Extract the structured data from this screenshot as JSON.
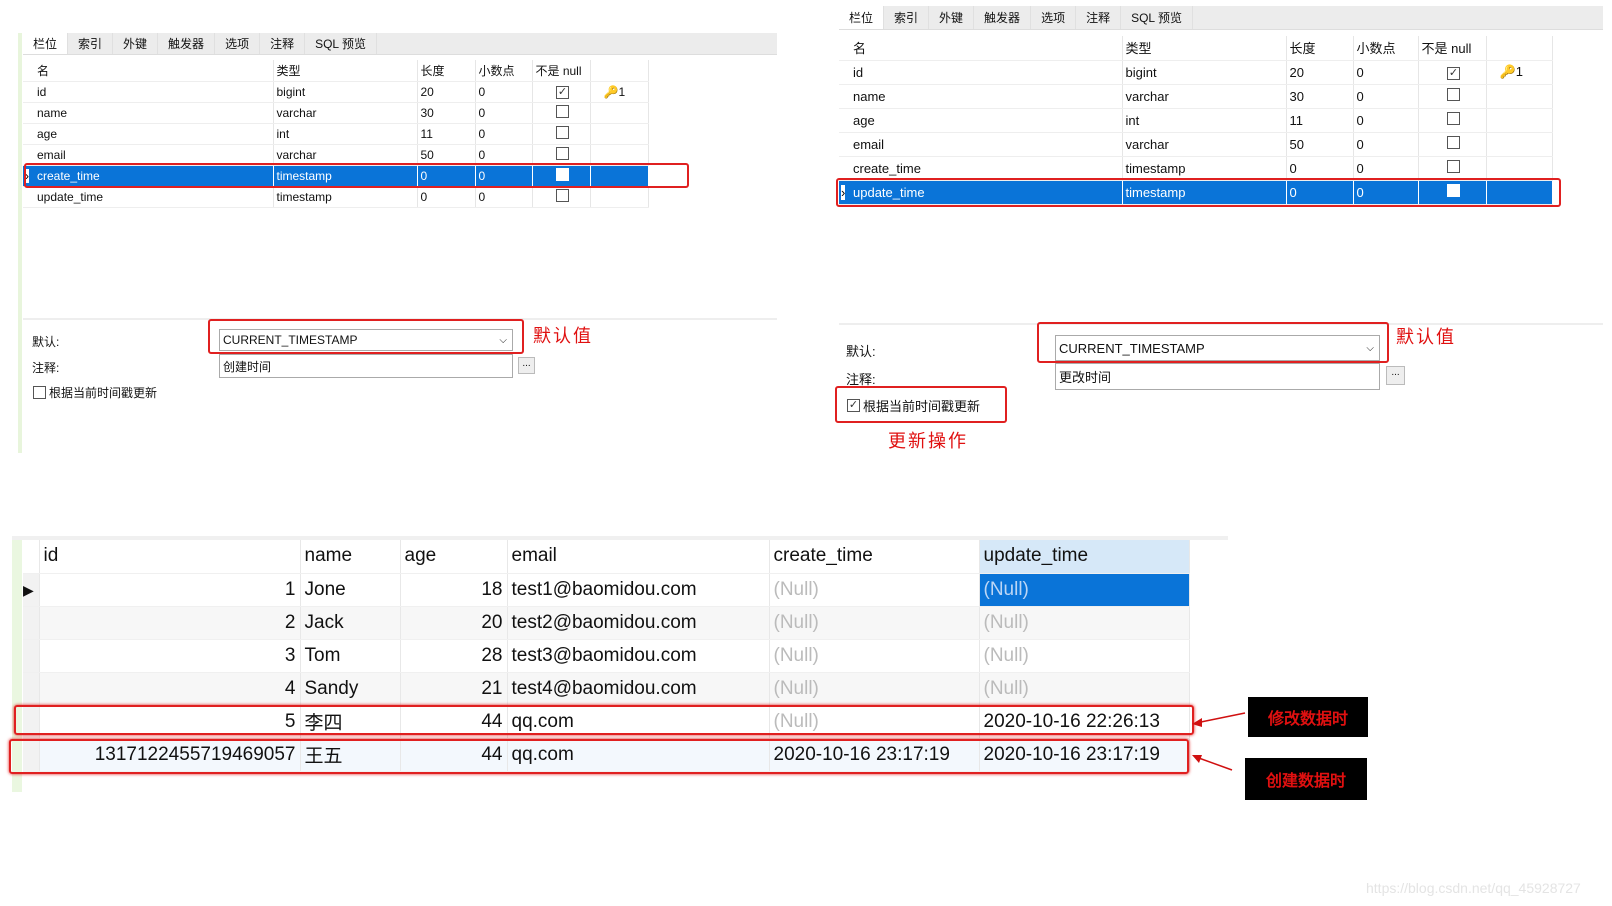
{
  "tabs": [
    "栏位",
    "索引",
    "外键",
    "触发器",
    "选项",
    "注释",
    "SQL 预览"
  ],
  "columns_header": [
    "名",
    "类型",
    "长度",
    "小数点",
    "不是 null",
    ""
  ],
  "fields": [
    {
      "name": "id",
      "type": "bigint",
      "length": "20",
      "decimal": "0",
      "not_null": true,
      "key": "1"
    },
    {
      "name": "name",
      "type": "varchar",
      "length": "30",
      "decimal": "0",
      "not_null": false,
      "key": ""
    },
    {
      "name": "age",
      "type": "int",
      "length": "11",
      "decimal": "0",
      "not_null": false,
      "key": ""
    },
    {
      "name": "email",
      "type": "varchar",
      "length": "50",
      "decimal": "0",
      "not_null": false,
      "key": ""
    },
    {
      "name": "create_time",
      "type": "timestamp",
      "length": "0",
      "decimal": "0",
      "not_null": false,
      "key": ""
    },
    {
      "name": "update_time",
      "type": "timestamp",
      "length": "0",
      "decimal": "0",
      "not_null": false,
      "key": ""
    }
  ],
  "left": {
    "selected_row": 4,
    "default_label": "默认:",
    "default_value": "CURRENT_TIMESTAMP",
    "comment_label": "注释:",
    "comment_value": "创建时间",
    "on_update_label": "根据当前时间戳更新",
    "on_update_checked": false,
    "note_default": "默认值"
  },
  "right": {
    "selected_row": 5,
    "default_label": "默认:",
    "default_value": "CURRENT_TIMESTAMP",
    "comment_label": "注释:",
    "comment_value": "更改时间",
    "on_update_label": "根据当前时间戳更新",
    "on_update_checked": true,
    "note_default": "默认值",
    "note_update": "更新操作"
  },
  "results": {
    "headers": [
      "id",
      "name",
      "age",
      "email",
      "create_time",
      "update_time"
    ],
    "rows": [
      [
        "1",
        "Jone",
        "18",
        "test1@baomidou.com",
        "(Null)",
        "(Null)"
      ],
      [
        "2",
        "Jack",
        "20",
        "test2@baomidou.com",
        "(Null)",
        "(Null)"
      ],
      [
        "3",
        "Tom",
        "28",
        "test3@baomidou.com",
        "(Null)",
        "(Null)"
      ],
      [
        "4",
        "Sandy",
        "21",
        "test4@baomidou.com",
        "(Null)",
        "(Null)"
      ],
      [
        "5",
        "李四",
        "44",
        "qq.com",
        "(Null)",
        "2020-10-16 22:26:13"
      ],
      [
        "1317122455719469057",
        "王五",
        "44",
        "qq.com",
        "2020-10-16 23:17:19",
        "2020-10-16 23:17:19"
      ]
    ],
    "label_modify": "修改数据时",
    "label_create": "创建数据时"
  },
  "watermark": "https://blog.csdn.net/qq_45928727",
  "colors": {
    "selection": "#0a74d8",
    "annotation": "#e01010"
  }
}
